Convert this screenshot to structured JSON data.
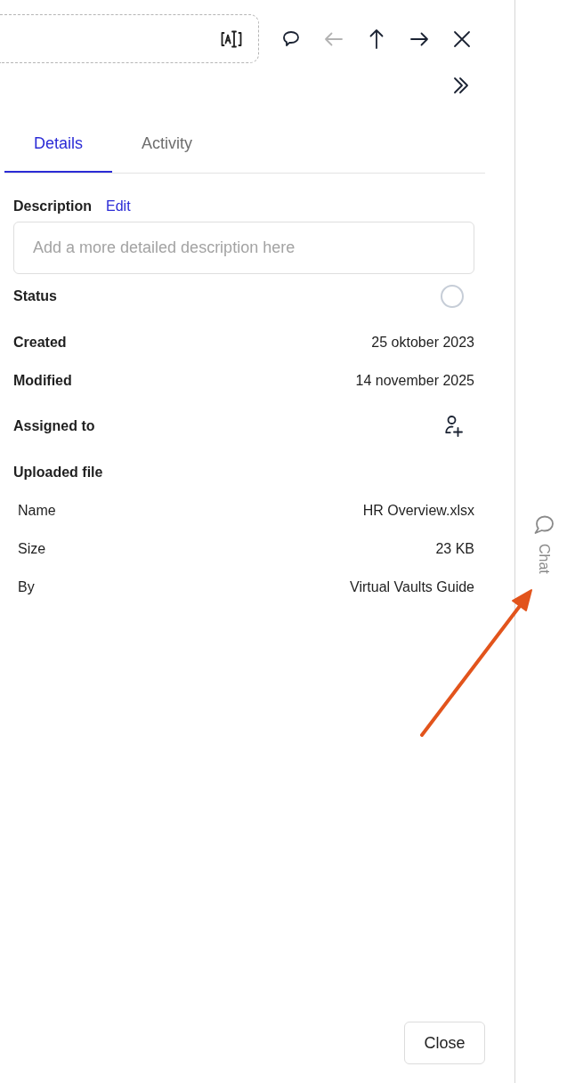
{
  "toolbar": {
    "buttons": [
      {
        "kind": "comment",
        "disabled": false
      },
      {
        "kind": "previous",
        "disabled": true
      },
      {
        "kind": "up",
        "disabled": false
      },
      {
        "kind": "next",
        "disabled": false
      },
      {
        "kind": "close",
        "disabled": false
      }
    ]
  },
  "tabs": [
    {
      "label": "Details",
      "selected": true
    },
    {
      "label": "Activity",
      "selected": false
    }
  ],
  "description": {
    "label": "Description",
    "action": "Edit",
    "placeholder": "Add a more detailed description here"
  },
  "properties": [
    {
      "kind": "status",
      "label": "Status",
      "checked": false
    },
    {
      "kind": "text",
      "label": "Created",
      "value": "25 oktober 2023"
    },
    {
      "kind": "text",
      "label": "Modified",
      "value": "14 november 2025"
    },
    {
      "kind": "assignee",
      "label": "Assigned to"
    }
  ],
  "uploaded_file": {
    "title": "Uploaded file",
    "rows": [
      {
        "label": "Name",
        "value": "HR Overview.xlsx"
      },
      {
        "label": "Size",
        "value": "23 KB"
      },
      {
        "label": "By",
        "value": "Virtual Vaults Guide"
      }
    ]
  },
  "close_button": {
    "label": "Close"
  },
  "chat_tab": {
    "label": "Chat"
  }
}
